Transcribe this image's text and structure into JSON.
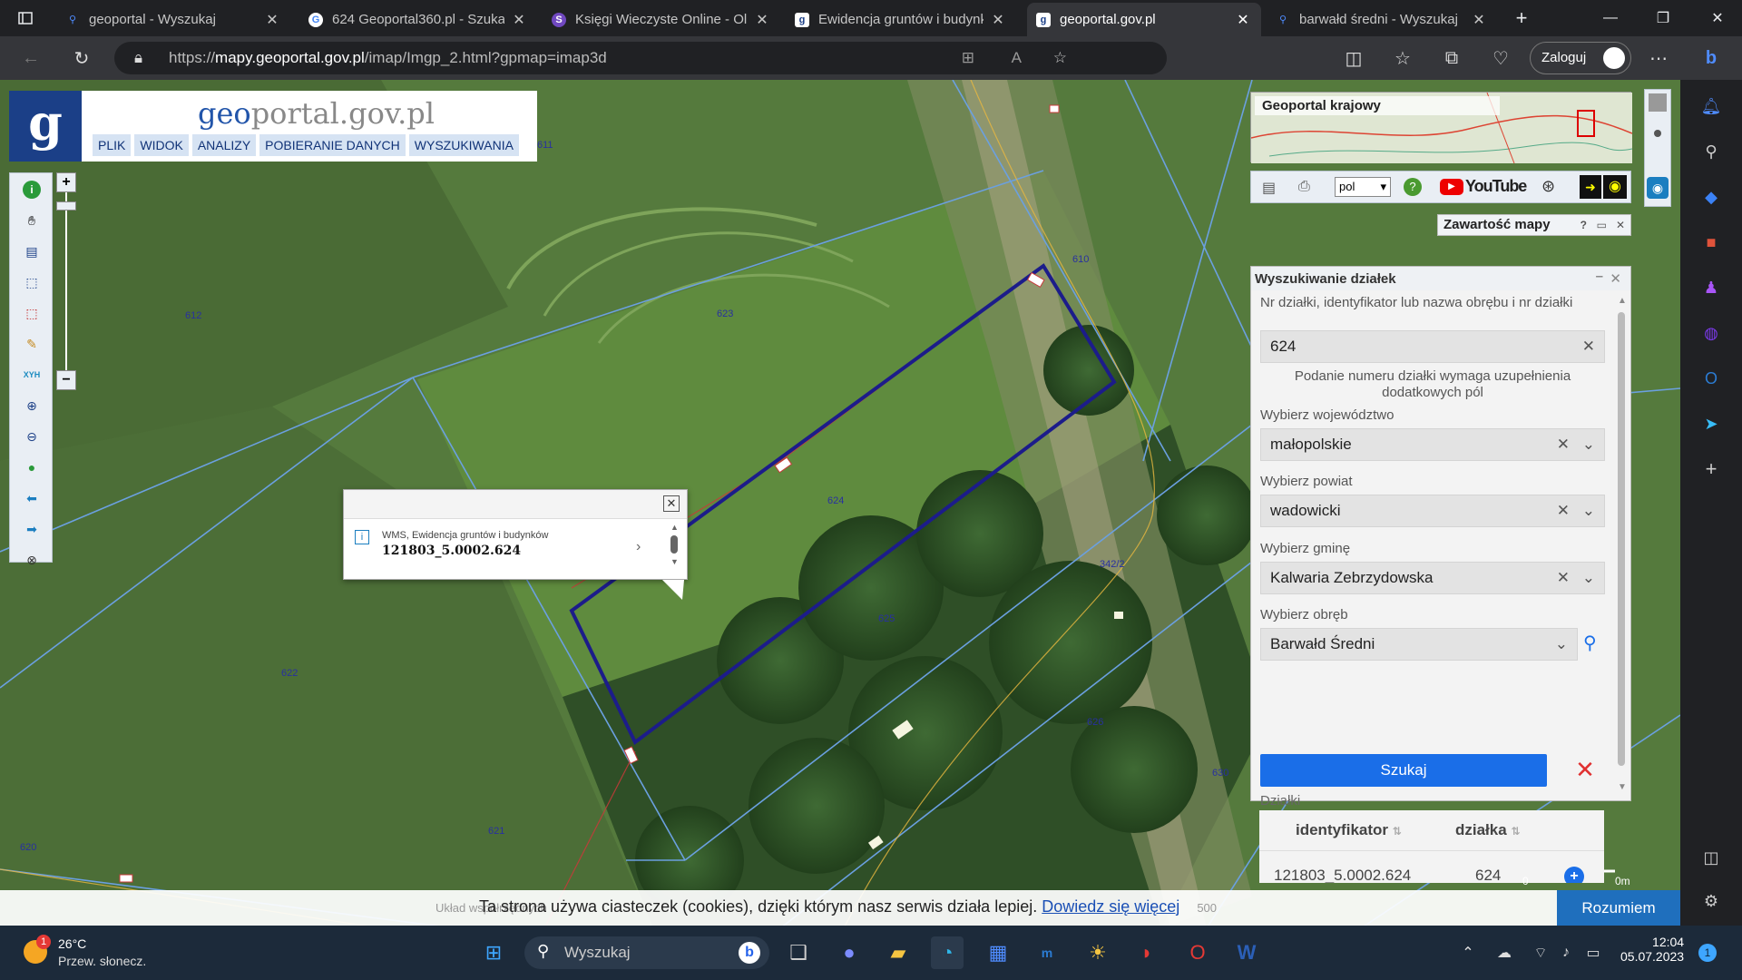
{
  "browser": {
    "tabs": [
      {
        "title": "geoportal - Wyszukaj",
        "icon": "search-icon",
        "color": "#4f8cff"
      },
      {
        "title": "624 Geoportal360.pl - Szuka",
        "icon": "google-icon",
        "color": "#ffffff"
      },
      {
        "title": "Księgi Wieczyste Online - Ol",
        "icon": "kw-icon",
        "color": "#7048c0"
      },
      {
        "title": "Ewidencja gruntów i budynk",
        "icon": "geoportal-icon",
        "color": "#ffffff"
      },
      {
        "title": "geoportal.gov.pl",
        "icon": "geoportal-icon",
        "color": "#ffffff"
      },
      {
        "title": "barwałd średni - Wyszukaj",
        "icon": "search-icon",
        "color": "#4f8cff"
      }
    ],
    "url_prefix": "https://",
    "url_host": "mapy.geoportal.gov.pl",
    "url_path": "/imap/Imgp_2.html?gpmap=imap3d",
    "login_label": "Zaloguj"
  },
  "geoportal": {
    "logo_text_a": "geo",
    "logo_text_b": "portal.gov.pl",
    "menu": [
      "PLIK",
      "WIDOK",
      "ANALIZY",
      "POBIERANIE DANYCH",
      "WYSZUKIWANIA"
    ],
    "overview_label": "Geoportal krajowy",
    "language": "pol",
    "youtube_label": "YouTube",
    "map_content_label": "Zawartość mapy"
  },
  "parcel_labels": {
    "p612": "612",
    "p611": "611",
    "p623": "623",
    "p624": "624",
    "p625": "625",
    "p622": "622",
    "p621": "621",
    "p620": "620",
    "p626": "626",
    "p630": "630",
    "p629": "629",
    "p610": "610",
    "p342": "342/2"
  },
  "popup": {
    "source": "WMS, Ewidencja gruntów i budynków",
    "identifier": "121803_5.0002.624"
  },
  "search_panel": {
    "title": "Wyszukiwanie działek",
    "parcel_label": "Nr działki, identyfikator lub nazwa obrębu i nr działki",
    "parcel_value": "624",
    "hint": "Podanie numeru działki wymaga uzupełnienia dodatkowych pól",
    "voivodeship_label": "Wybierz województwo",
    "voivodeship_value": "małopolskie",
    "county_label": "Wybierz powiat",
    "county_value": "wadowicki",
    "commune_label": "Wybierz gminę",
    "commune_value": "Kalwaria Zebrzydowska",
    "precinct_label": "Wybierz obręb",
    "precinct_value": "Barwałd Średni",
    "search_button": "Szukaj",
    "results_label": "Działki",
    "col_identifier": "identyfikator",
    "col_parcel": "działka",
    "row_identifier": "121803_5.0002.624",
    "row_parcel": "624"
  },
  "cookie": {
    "text": "Ta strona używa ciasteczek (cookies), dzięki którym nasz serwis działa lepiej.",
    "link": "Dowiedz się więcej",
    "button": "Rozumiem"
  },
  "map_footer": {
    "scale_right": "0m",
    "scale_left": "0",
    "coords_hint": "Układ współrzędnych",
    "coords_value": "500"
  },
  "taskbar": {
    "temperature": "26°C",
    "weather": "Przew. słonecz.",
    "weather_badge": "1",
    "search_placeholder": "Wyszukaj",
    "time": "12:04",
    "date": "05.07.2023",
    "notif_badge": "1"
  }
}
